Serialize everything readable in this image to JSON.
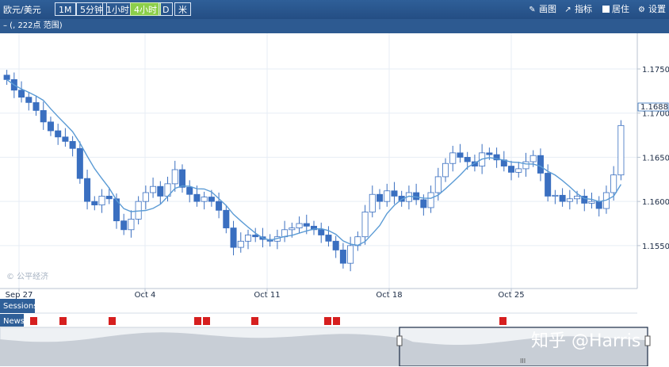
{
  "toolbar": {
    "symbol": "欧元/美元",
    "timeframes": [
      {
        "label": "1M",
        "active": false
      },
      {
        "label": "5分钟",
        "active": false
      },
      {
        "label": "1小时",
        "active": false
      },
      {
        "label": "4小时",
        "active": true
      },
      {
        "label": "D",
        "active": false
      },
      {
        "label": "米",
        "active": false
      }
    ],
    "draw_label": "画图",
    "indicators_label": "指标",
    "center_label": "居住",
    "settings_label": "设置"
  },
  "subbar": {
    "text": "– (, 222点 范围)"
  },
  "watermark_text": "© 公平经济",
  "sessions_label": "Sessions",
  "news_label": "News",
  "overlay_watermark": "知乎 @Harris",
  "colors": {
    "candle": "#3a6fc0",
    "ma": "#5b9bd5",
    "news": "#d61f1f",
    "toolbar": "#2f5f98",
    "grid": "#e7edf5"
  },
  "chart_data": {
    "type": "candlestick",
    "x_ticks": [
      "Sep 27",
      "Oct 4",
      "Oct 11",
      "Oct 18",
      "Oct 25"
    ],
    "y_ticks": [
      "1.1750",
      "1.1700",
      "1.1650",
      "1.1600",
      "1.1550"
    ],
    "ylim": [
      1.1505,
      1.1785
    ],
    "last_price": "1.1688",
    "close_series": [
      1.1738,
      1.1726,
      1.1718,
      1.1712,
      1.1703,
      1.169,
      1.168,
      1.1673,
      1.1668,
      1.166,
      1.1626,
      1.16,
      1.1596,
      1.1606,
      1.1603,
      1.1578,
      1.1568,
      1.158,
      1.16,
      1.161,
      1.1617,
      1.1606,
      1.162,
      1.1636,
      1.1616,
      1.1608,
      1.16,
      1.1605,
      1.16,
      1.159,
      1.157,
      1.1548,
      1.1555,
      1.1562,
      1.156,
      1.1557,
      1.1555,
      1.156,
      1.1568,
      1.157,
      1.1575,
      1.1572,
      1.1568,
      1.1562,
      1.1555,
      1.1545,
      1.153,
      1.155,
      1.156,
      1.1588,
      1.1608,
      1.16,
      1.1612,
      1.1606,
      1.16,
      1.161,
      1.1602,
      1.1593,
      1.161,
      1.1628,
      1.1643,
      1.1655,
      1.165,
      1.1645,
      1.164,
      1.1655,
      1.1653,
      1.1647,
      1.164,
      1.1633,
      1.1637,
      1.1645,
      1.1652,
      1.1632,
      1.1606,
      1.1607,
      1.16,
      1.1603,
      1.1606,
      1.1598,
      1.16,
      1.1592,
      1.161,
      1.163,
      1.1686
    ]
  }
}
